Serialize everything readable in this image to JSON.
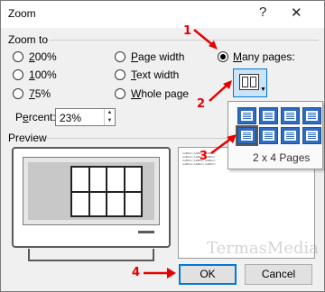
{
  "window": {
    "title": "Zoom",
    "help_glyph": "?",
    "close_glyph": "✕"
  },
  "zoom_to": {
    "label": "Zoom to",
    "options": [
      {
        "label": "200%",
        "selected": false
      },
      {
        "label": "100%",
        "selected": false
      },
      {
        "label": "75%",
        "selected": false
      },
      {
        "label": "Page width",
        "selected": false
      },
      {
        "label": "Text width",
        "selected": false
      },
      {
        "label": "Whole page",
        "selected": false
      },
      {
        "label": "Many pages:",
        "selected": true
      }
    ],
    "percent_label": "Percent:",
    "percent_value": "23%"
  },
  "preview": {
    "label": "Preview",
    "doc_lines": [
      "AaBbCc AaBbCc AaBbCc",
      "AaBbCc AaBbCc AaBbCc",
      "AaBbCc AaBbCc AaBbCc",
      "AaBbCc AaBbCc AaBbCc"
    ]
  },
  "many_pages_popup": {
    "grid_label": "2 x 4 Pages",
    "rows": 2,
    "cols": 4,
    "selected_rows": 2,
    "selected_cols": 4
  },
  "annotations": {
    "step1": "1",
    "step2": "2",
    "step3": "3",
    "step4": "4",
    "color": "#e60000"
  },
  "buttons": {
    "ok": "OK",
    "cancel": "Cancel"
  },
  "watermark": "TermasMedia",
  "icons": {
    "many_pages_button": "multiple-pages-icon",
    "dropdown": "chevron-down-icon"
  }
}
